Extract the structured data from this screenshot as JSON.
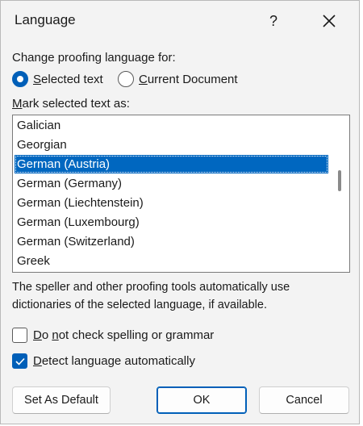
{
  "dialog": {
    "title": "Language",
    "help_label": "?"
  },
  "proofing": {
    "heading": "Change proofing language for:",
    "option_selected_text": {
      "prefix": "S",
      "rest": "elected text",
      "checked": true
    },
    "option_current_document": {
      "prefix": "C",
      "rest": "urrent Document",
      "checked": false
    }
  },
  "mark": {
    "label_prefix": "M",
    "label_rest": "ark selected text as:"
  },
  "languages": {
    "items": [
      "Galician",
      "Georgian",
      "German (Austria)",
      "German (Germany)",
      "German (Liechtenstein)",
      "German (Luxembourg)",
      "German (Switzerland)",
      "Greek"
    ],
    "selected": "German (Austria)"
  },
  "info_text": "The speller and other proofing tools automatically use dictionaries of the selected language, if available.",
  "checks": {
    "no_check": {
      "prefix": "D",
      "mid": "o ",
      "ul": "n",
      "rest": "ot check spelling or grammar",
      "checked": false
    },
    "detect": {
      "prefix": "D",
      "rest": "etect language automatically",
      "checked": true
    }
  },
  "buttons": {
    "set_default": "Set As Default",
    "ok": "OK",
    "cancel": "Cancel"
  },
  "colors": {
    "accent": "#005fb8",
    "selection": "#0067c0",
    "dialog_bg": "#f3f3f3"
  }
}
